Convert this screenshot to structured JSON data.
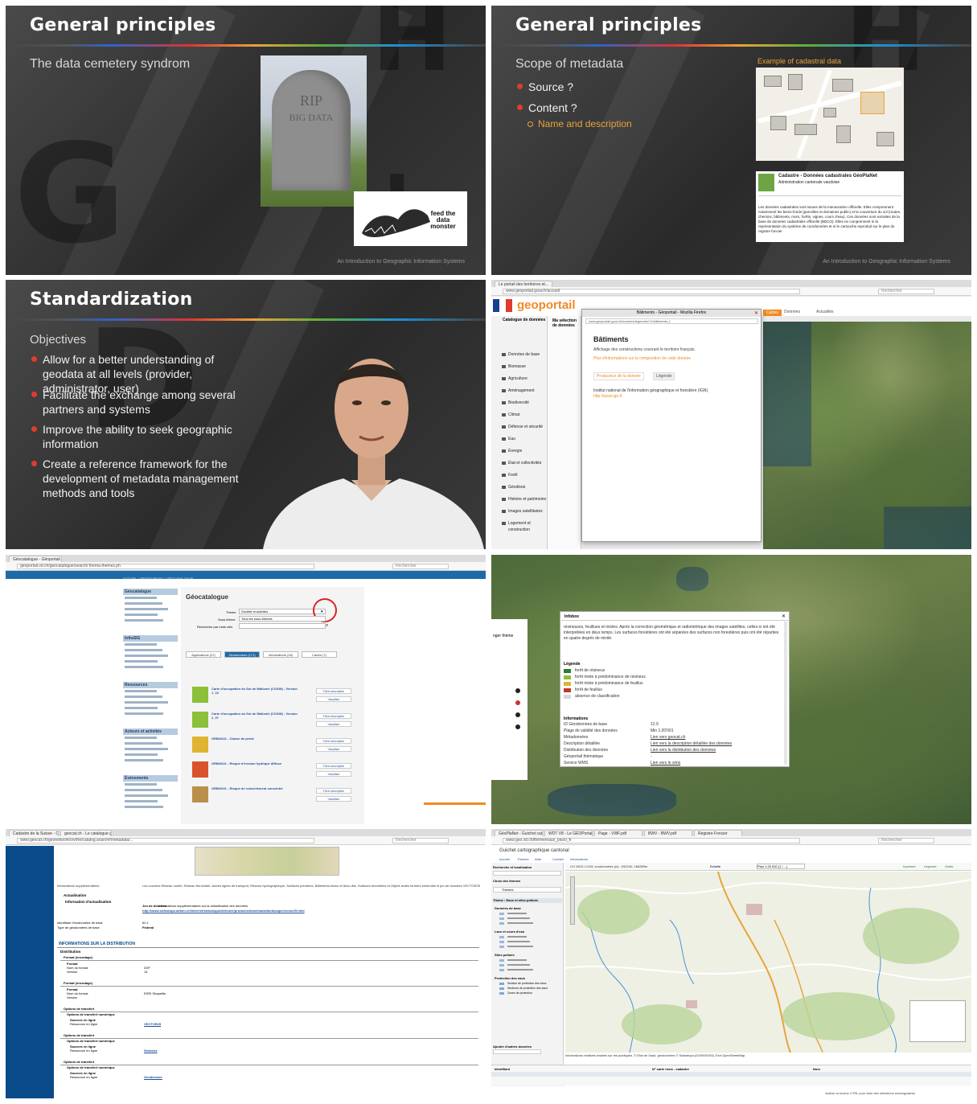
{
  "slide1": {
    "title": "General principles",
    "subtitle": "The data cemetery syndrom",
    "tombstone_line1": "RIP",
    "tombstone_line2": "BIG DATA",
    "monster_caption": "feed the data monster",
    "footer": "An Introduction to Geographic Information Systems"
  },
  "slide2": {
    "title": "General principles",
    "subtitle": "Scope of metadata",
    "bullets": [
      "Source ?",
      "Content ?"
    ],
    "subbullet": "Name and description",
    "map_caption": "Example of cadastral data",
    "meta_title": "Cadastre - Données cadastrales GéoPlaNet",
    "meta_sub": "Administration cantonale vaudoise",
    "meta_body": "Les données cadastrales sont issues de la mensuration officielle. Elles comprennent notamment les biens-fonds (parcelles et domaines public) et la couverture du sol (routes, chemins, bâtiments, murs, forêts, vignes, cours d'eau). Ces données sont extraites de la base de données cadastrales officielle (BDCO). Elles ne comprennent ni la représentation du système de coordonnées et ni le cartouche reproduit sur le plan du registre foncier",
    "footer": "An Introduction to Geographic Information Systems"
  },
  "slide3": {
    "title": "Standardization",
    "subtitle": "Objectives",
    "bullets": [
      "Allow for a better understanding of geodata at all levels (provider, administrator, user)",
      "Facilitate the exchange among several partners and systems",
      "Improve the ability to seek geographic information",
      "Create a reference framework for the development of metadata management methods and tools"
    ]
  },
  "geoportail": {
    "tab": "Le portail des territoires et...",
    "url": "www.geoportail.gouv.fr/accueil",
    "search": "Rechercher",
    "logo": "geoportail",
    "nav": [
      "Cartes",
      "Données",
      "Actualités"
    ],
    "popup_title": "Bâtiments - Géoportail - Mozilla Firefox",
    "popup_url": "www.geoportail.gouv.fr/donnees/legendes/?1/bâtiments_f",
    "heading": "Bâtiments",
    "desc": "Affichage des constructions couvrant le territoire français.",
    "more": "Plus d'informations sur la composition de cette donnée",
    "tab_producer": "Producteur de la donnée",
    "tab_legend": "Légende",
    "producer": "Institut national de l'information géographique et forestière (IGN)",
    "producer_url": "http://www.ign.fr",
    "catalog_title": "Catalogue de données",
    "catalog_items": [
      "Données de base",
      "Biomasse",
      "Agriculture",
      "Aménagement",
      "Biodiversité",
      "Climat",
      "Défense et sécurité",
      "Eau",
      "Énergie",
      "État et collectivités",
      "Forêt",
      "Géodésie",
      "Histoire et patrimoine",
      "Images satellitaires",
      "Logement et construction"
    ],
    "selection": "Ma sélection de données"
  },
  "geocat": {
    "tab": "Géocatalogue - Géoportail...",
    "url": "geoportail.vd.ch/geocatalogue/search/ thema-themes.ph",
    "search": "Rechercher",
    "breadcrumb": "ACCUEIL > RESSOURCES > GÉOCATALOGUE",
    "title": "Géocatalogue",
    "label_theme": "Thème",
    "theme_value": "Société et activités",
    "label_subtheme": "Sous-thème",
    "subtheme_value": "Tous les sous-thèmes",
    "label_search": "Recherche par mots clés",
    "tabs": [
      "Applications (37)",
      "Géodonnées (171)",
      "Informations (18)",
      "Cartes (7)"
    ],
    "results": [
      "Carte d'occupation du Sol de Wallonie (COSW) - Version 1_10",
      "Carte d'occupation du Sol de Wallonie (COSW) - Version 2_07",
      "ORBI2021 - Classe de pente",
      "ORBI2021 - Risque d'érosion hydrique diffuse",
      "ORBI2021 - Risque de ruissellement concentré"
    ],
    "side_sections": [
      "Géocatalogue",
      "InfraSIG",
      "Ressources",
      "Acteurs et activités",
      "Évènements"
    ],
    "button_sheet": "Fiche descriptive",
    "button_view": "Visualiser"
  },
  "infobox": {
    "title": "Infobox",
    "intro": "résineuses, feuillues et mixtes. Après la correction géométrique et radiométrique des images satellites, celles-ci ont été interprétées en deux temps. Les surfaces forestières ont été séparées des surfaces non forestières puis ont été réparties en quatre degrés de mixité.",
    "legend_title": "Légende",
    "legend": [
      {
        "label": "forêt de résineux",
        "color": "#2f7d32"
      },
      {
        "label": "forêt mixte à prédominance de résineux",
        "color": "#8cbf3a"
      },
      {
        "label": "forêt mixte à prédominance de feuillus",
        "color": "#e0b431"
      },
      {
        "label": "forêt de feuillus",
        "color": "#c0392b"
      },
      {
        "label": "absence de classification",
        "color": "#d8d8d8"
      }
    ],
    "info_title": "Informations",
    "info": [
      {
        "key": "ID Géodonnées de base",
        "value": "12.9"
      },
      {
        "key": "Plage de validité des données",
        "value": "Min 1:20'001"
      },
      {
        "key": "Métadonnées",
        "value": "Lien vers geocat.ch"
      },
      {
        "key": "Description détaillée",
        "value": "Lien vers la description détaillée des données"
      },
      {
        "key": "Distribution des données",
        "value": "Lien vers la distribution des données"
      },
      {
        "key": "Géoportail thématique",
        "value": "-"
      },
      {
        "key": "Service WMS",
        "value": "Lien vers le wms"
      }
    ],
    "side_label": "nger thème"
  },
  "geocatch": {
    "tabs": [
      "Cadastre de la Suisse - Confé...",
      "geocat.ch - Le catalogue g..."
    ],
    "url": "www.geocat.ch/geonetwork/srv/fre/catalog.search#/metadata/...",
    "search": "Rechercher",
    "section_info": "Informations supplémentaires",
    "topic_text": "Les couches Réseau routier, Réseau ferroviaire, Autres lignes de transport, Réseau hydrographique, Surfaces primaires, Bâtiments-Noms et lieux-dits, Surfaces forestières et Objets isolés forment ensemble le jeu de données VECTOR25",
    "update": "Actualisation",
    "update_info": "Information d'actualisation",
    "dataset_label": "Jeu de données",
    "dataset_text": "Informations supplémentaires sur la classification des données",
    "dataset_link": "http://www.swisstopo.admin.ch/internet/swisstopo/de/home/products/downloads/landscape/vector25.html",
    "id_label": "Identifiant Géodonnées de base",
    "id_value": "62.1",
    "type_label": "Type de géodonnées de base",
    "type_value": "Fédéral",
    "distribution_title": "INFORMATIONS SUR LA DISTRIBUTION",
    "distribution": "Distribution",
    "format_encoding": "Format (encodage)",
    "format": "Format",
    "format_name_label": "Nom du format",
    "format_name": "DXF",
    "version_label": "Version",
    "version": "14",
    "format2_name": "ESRI Shapefile",
    "transfer_options": "Options de transfert",
    "transfer_digital": "Options de transfert numérique",
    "online_source": "Sources en ligne",
    "resource_label": "Ressource en ligne",
    "resources": [
      "VECTOR25",
      "Swisstzz",
      "Geodienwer"
    ]
  },
  "guichet": {
    "tabs": [
      "GéoPlaNet - Guichet carto...",
      "WDT V8 - Le GÉOPortail v...",
      "Page - VWF.pdf",
      "BWV - BWV.pdf",
      "Registre Foncier"
    ],
    "url": "www.geo.vd.ch/theme/eaux_piezo_fr",
    "search": "Rechercher",
    "title": "Guichet cartographique cantonal",
    "menu": [
      "Accueil",
      "Thèmes",
      "Aide",
      "Contact",
      "Informations"
    ],
    "panel_search": "Recherche et localisation",
    "panel_theme": "Choix des thèmes",
    "theme_value": "Thèmes",
    "layers_title": "Thème : Eaux et sites pollués",
    "layers": [
      "Données de base",
      "Lacs et cours d'eau",
      "Sites pollués",
      "Protection des eaux"
    ],
    "layers_sub": [
      "Surface de protection des eaux",
      "Secteurs de protection des eaux",
      "Zones de protection"
    ],
    "add_data": "Ajouter d'autres données",
    "coords": "CH 1903 / LV03, coordonnées (m) : 532240, 166289m",
    "scale_label": "Echelle",
    "scale_value": "Plan 1:25 000 (1 / ...)",
    "toolbar": [
      "Imprimer",
      "Légende",
      "Outils"
    ],
    "attribution": "Informations relatives basées sur les publiques, © Etat de Vaud, géodonnées © Swisstopo (DV0000193), Esri OpenStreetMap",
    "table_head": [
      "Identifiant",
      "N° carte rivus - cadastre",
      "Nom"
    ],
    "status": "Activer la touche CTRL pour faire des sélections rectangulaires"
  },
  "colors": {
    "slide_red": "#e23b2e",
    "slide_orange": "#e8a43a",
    "geoportail_orange": "#f08a24",
    "geocat_blue": "#0a4b8a",
    "link_blue": "#2060b0"
  }
}
